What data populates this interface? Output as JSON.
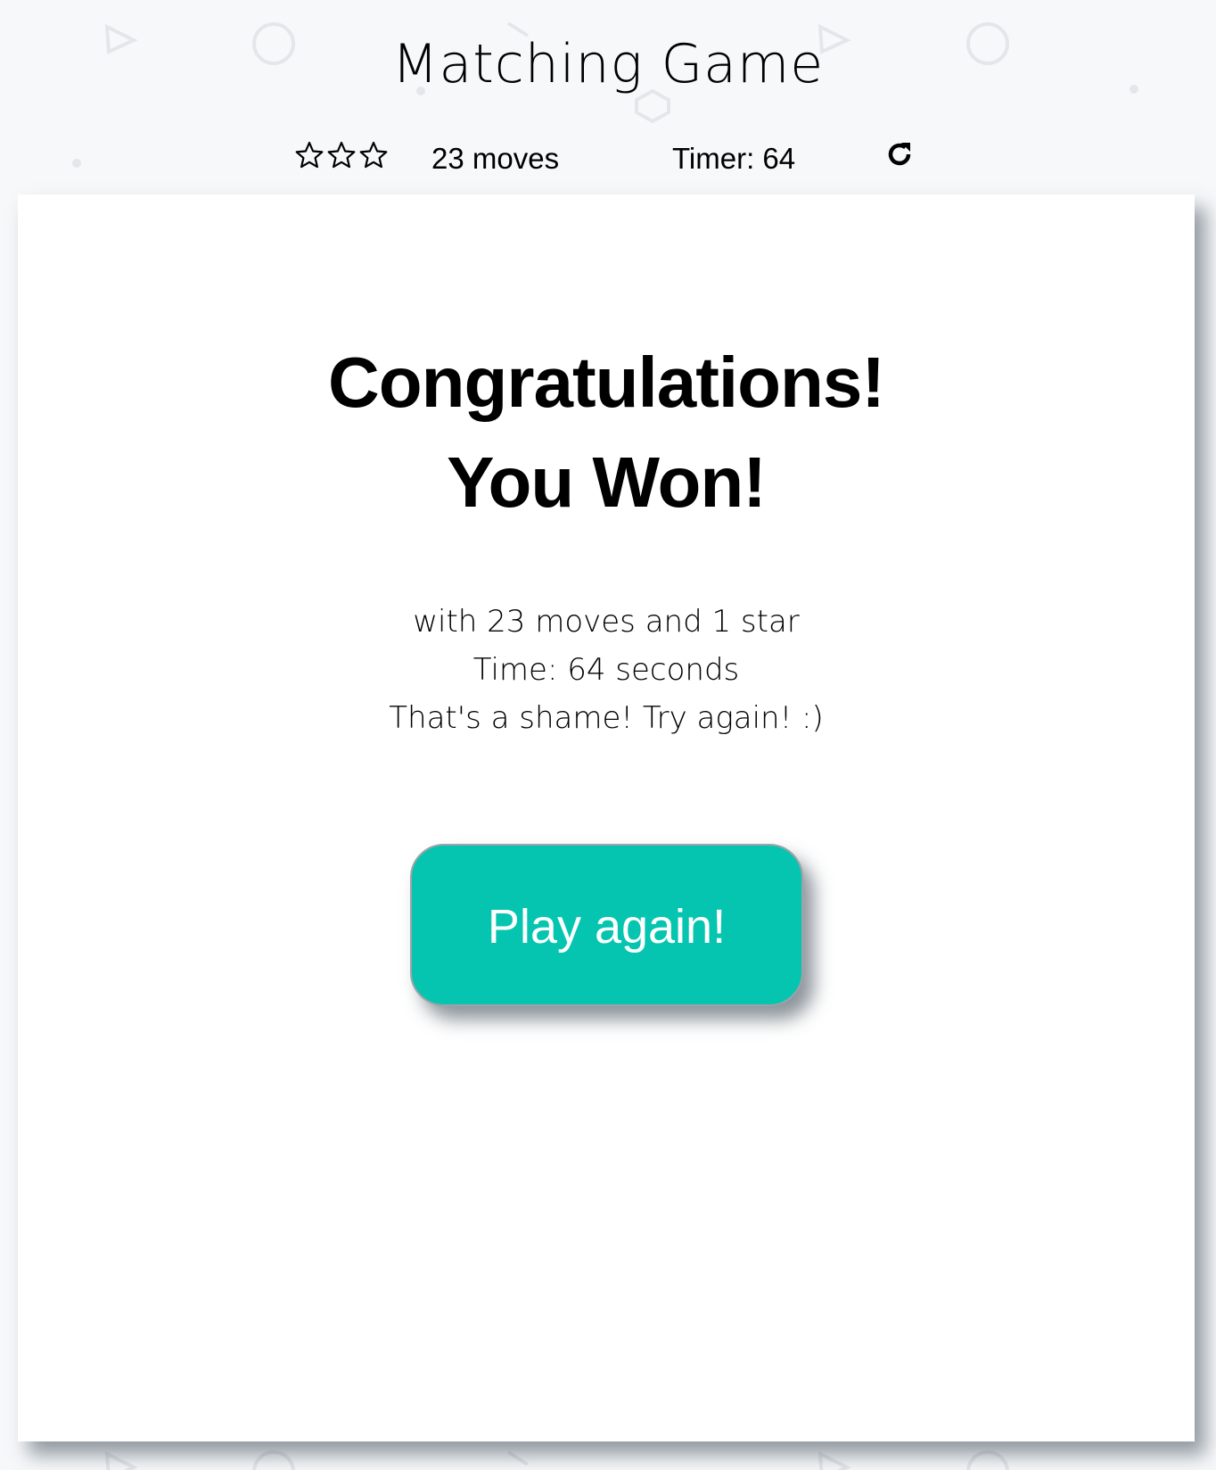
{
  "title": "Matching Game",
  "score_panel": {
    "stars": [
      {
        "icon": "star-outline-icon",
        "filled": false
      },
      {
        "icon": "star-outline-icon",
        "filled": false
      },
      {
        "icon": "star-outline-icon",
        "filled": false
      }
    ],
    "moves_label": "23 moves",
    "timer_label": "Timer: 64",
    "restart_icon": "restart-icon"
  },
  "modal": {
    "heading": [
      "Congratulations!",
      "You Won!"
    ],
    "details": [
      "with 23 moves and 1 star",
      "Time: 64 seconds",
      "That's a shame! Try again! :)"
    ],
    "play_again_label": "Play again!"
  },
  "colors": {
    "background": "#f7f8fa",
    "card": "#ffffff",
    "button": "#05c5b1",
    "button_text": "#ffffff",
    "text": "#000000"
  }
}
